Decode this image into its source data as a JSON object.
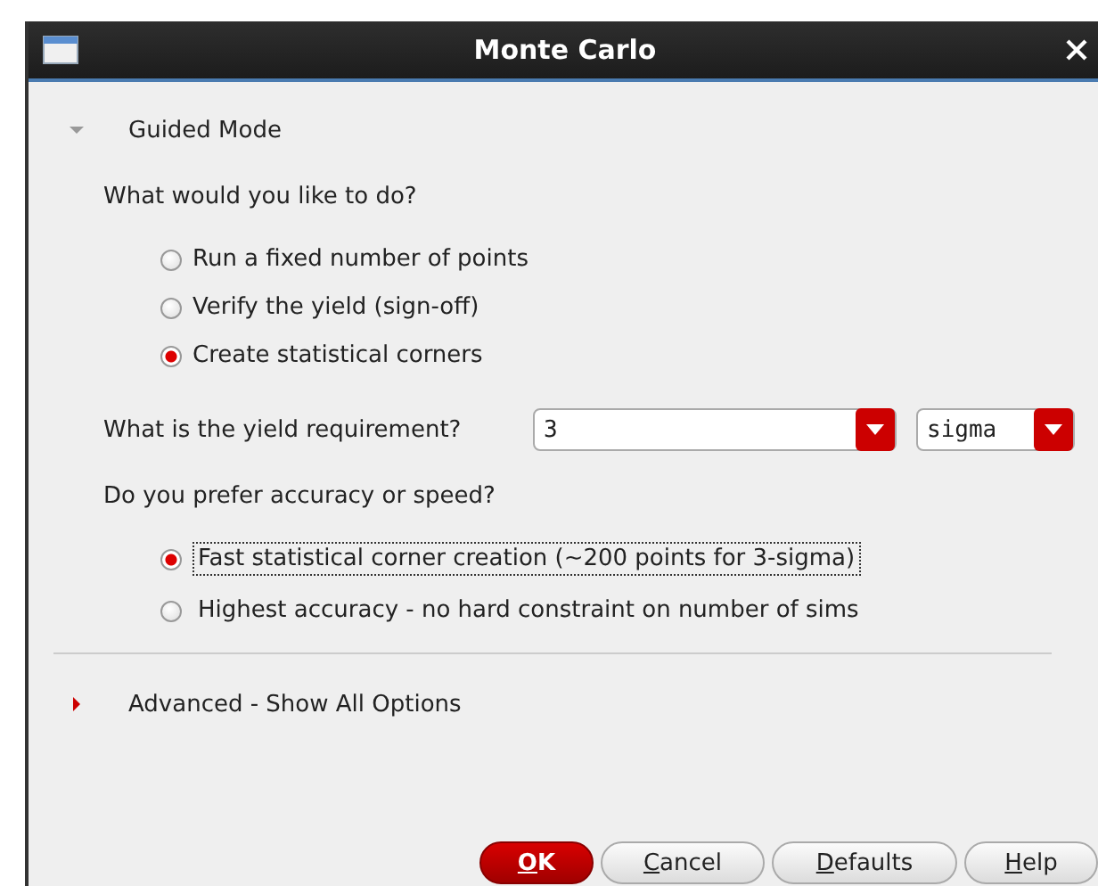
{
  "window": {
    "title": "Monte Carlo"
  },
  "guided_section": {
    "label": "Guided Mode",
    "expanded": true
  },
  "question_1": "What would you like to do?",
  "actions": [
    {
      "label": "Run a fixed number of points",
      "selected": false
    },
    {
      "label": "Verify the yield (sign-off)",
      "selected": false
    },
    {
      "label": "Create statistical corners",
      "selected": true
    }
  ],
  "yield_requirement": {
    "label": "What is the yield requirement?",
    "value": "3",
    "unit": "sigma"
  },
  "question_2": "Do you prefer accuracy or speed?",
  "accuracy_options": [
    {
      "label": "Fast statistical corner creation (~200 points for 3-sigma)",
      "selected": true,
      "focused": true
    },
    {
      "label": "Highest accuracy - no hard constraint on number of sims",
      "selected": false,
      "focused": false
    }
  ],
  "advanced_section": {
    "label": "Advanced - Show All Options",
    "expanded": false
  },
  "buttons": [
    {
      "label": "OK",
      "first_letter_underlined": true,
      "kind": "default"
    },
    {
      "label": "Cancel",
      "first_letter_underlined": true,
      "kind": "normal"
    },
    {
      "label": "Defaults",
      "first_letter_underlined": true,
      "kind": "normal"
    },
    {
      "label": "Help",
      "first_letter_underlined": true,
      "kind": "normal"
    }
  ]
}
